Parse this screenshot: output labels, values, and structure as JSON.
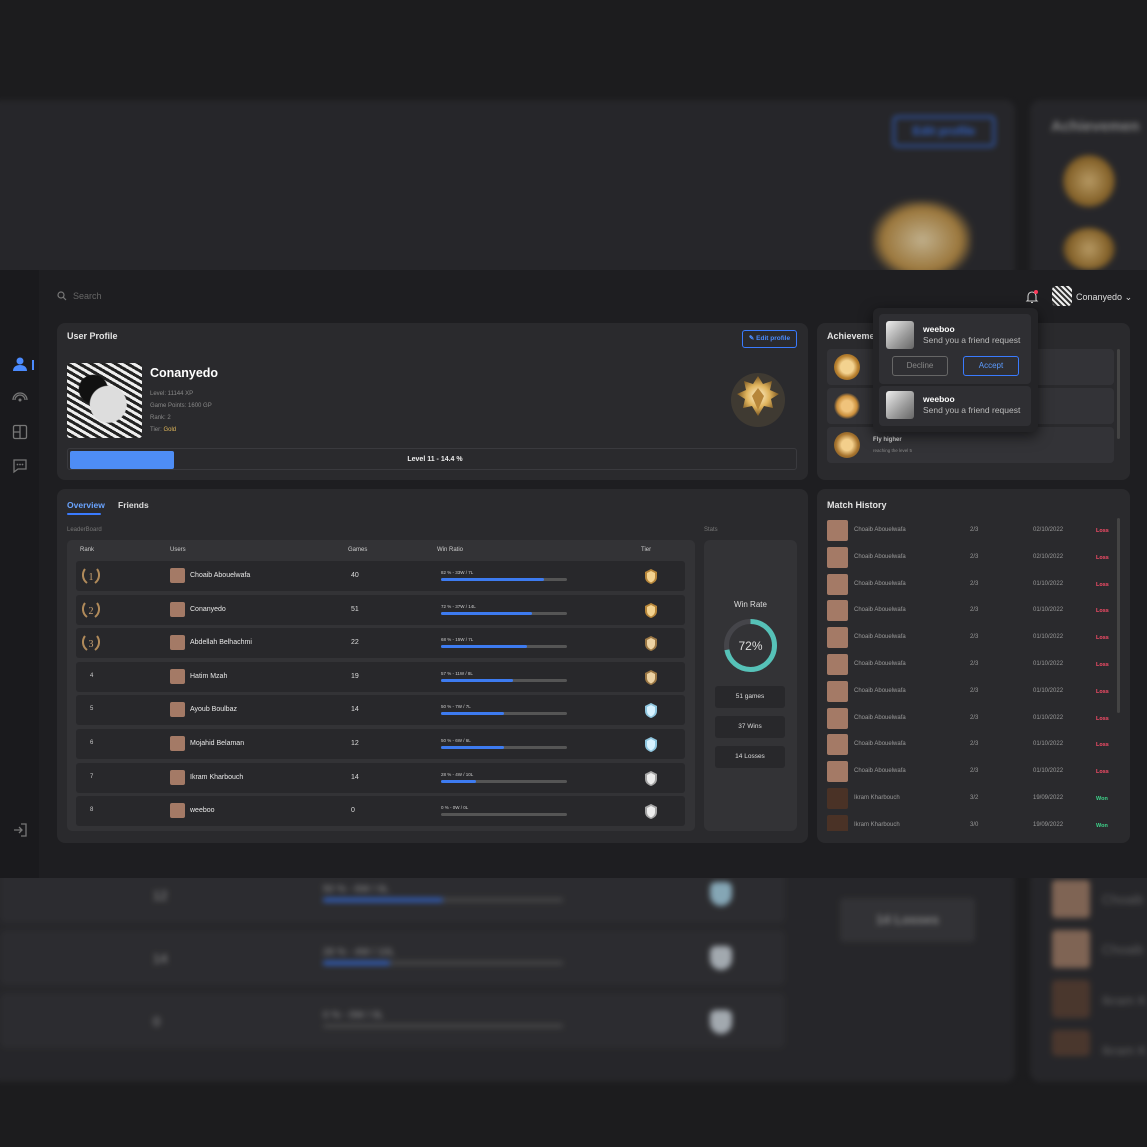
{
  "background": {
    "edit_label": "Edit profile",
    "achievements_title": "Achievemen",
    "rows": [
      {
        "games": "12",
        "ratio": "50 % - 6W / 6L",
        "fill": 0.5
      },
      {
        "games": "14",
        "ratio": "28 % - 4W / 10L",
        "fill": 0.28
      },
      {
        "games": "0",
        "ratio": "0 % - 0W / 0L",
        "fill": 0
      }
    ],
    "losses": "14 Losses",
    "names": [
      "Choaib",
      "Choaib",
      "Ikram K",
      "Ikram K"
    ]
  },
  "sidebar": {
    "icons": [
      "user-icon",
      "radar-icon",
      "game-board-icon",
      "chat-icon",
      "logout-icon"
    ]
  },
  "topbar": {
    "search_placeholder": "Search",
    "username": "Conanyedo",
    "chevron": "⌄"
  },
  "profile": {
    "title": "User Profile",
    "edit_label": "Edit profile",
    "name": "Conanyedo",
    "level": "Level: 11144 XP",
    "points": "Game Points: 1600 GP",
    "rank": "Rank: 2",
    "tier_label": "Tier:",
    "tier": "Gold",
    "xp_text": "Level 11 - 14.4 %",
    "xp_progress": 0.144
  },
  "achievements": {
    "title": "Achievemen",
    "items": [
      {
        "name": "",
        "desc": ""
      },
      {
        "name": "",
        "desc": ""
      },
      {
        "name": "Fly higher",
        "desc": "reaching the level 5"
      }
    ]
  },
  "notifications": {
    "items": [
      {
        "name": "weeboo",
        "message": "Send you a friend request"
      },
      {
        "name": "weeboo",
        "message": "Send you a friend request"
      }
    ],
    "decline": "Decline",
    "accept": "Accept"
  },
  "tabs": {
    "overview": "Overview",
    "friends": "Friends"
  },
  "leaderboard": {
    "label": "LeaderBoard",
    "headers": {
      "rank": "Rank",
      "users": "Users",
      "games": "Games",
      "ratio": "Win Ratio",
      "tier": "Tier"
    },
    "rows": [
      {
        "rank": "1",
        "user": "Choaib Abouelwafa",
        "games": "40",
        "ratio": "82 % - 33W / 7L",
        "fill": 0.82,
        "tier": "gold"
      },
      {
        "rank": "2",
        "user": "Conanyedo",
        "games": "51",
        "ratio": "72 % - 37W / 14L",
        "fill": 0.72,
        "tier": "gold"
      },
      {
        "rank": "3",
        "user": "Abdellah Belhachmi",
        "games": "22",
        "ratio": "68 % - 15W / 7L",
        "fill": 0.68,
        "tier": "silver"
      },
      {
        "rank": "4",
        "user": "Hatim Mzah",
        "games": "19",
        "ratio": "57 % - 11W / 8L",
        "fill": 0.57,
        "tier": "silver"
      },
      {
        "rank": "5",
        "user": "Ayoub Boulbaz",
        "games": "14",
        "ratio": "50 % - 7W / 7L",
        "fill": 0.5,
        "tier": "diamond"
      },
      {
        "rank": "6",
        "user": "Mojahid Belaman",
        "games": "12",
        "ratio": "50 % - 6W / 6L",
        "fill": 0.5,
        "tier": "diamond"
      },
      {
        "rank": "7",
        "user": "Ikram Kharbouch",
        "games": "14",
        "ratio": "28 % - 4W / 10L",
        "fill": 0.28,
        "tier": "platinum"
      },
      {
        "rank": "8",
        "user": "weeboo",
        "games": "0",
        "ratio": "0 % - 0W / 0L",
        "fill": 0,
        "tier": "platinum"
      }
    ]
  },
  "stats": {
    "label": "Stats",
    "win_rate_label": "Win Rate",
    "win_rate": "72%",
    "win_rate_value": 0.72,
    "games": "51 games",
    "wins": "37 Wins",
    "losses": "14 Losses"
  },
  "match_history": {
    "title": "Match History",
    "rows": [
      {
        "name": "Choaib Abouelwafa",
        "score": "2/3",
        "date": "02/10/2022",
        "result": "Loss"
      },
      {
        "name": "Choaib Abouelwafa",
        "score": "2/3",
        "date": "02/10/2022",
        "result": "Loss"
      },
      {
        "name": "Choaib Abouelwafa",
        "score": "2/3",
        "date": "01/10/2022",
        "result": "Loss"
      },
      {
        "name": "Choaib Abouelwafa",
        "score": "2/3",
        "date": "01/10/2022",
        "result": "Loss"
      },
      {
        "name": "Choaib Abouelwafa",
        "score": "2/3",
        "date": "01/10/2022",
        "result": "Loss"
      },
      {
        "name": "Choaib Abouelwafa",
        "score": "2/3",
        "date": "01/10/2022",
        "result": "Loss"
      },
      {
        "name": "Choaib Abouelwafa",
        "score": "2/3",
        "date": "01/10/2022",
        "result": "Loss"
      },
      {
        "name": "Choaib Abouelwafa",
        "score": "2/3",
        "date": "01/10/2022",
        "result": "Loss"
      },
      {
        "name": "Choaib Abouelwafa",
        "score": "2/3",
        "date": "01/10/2022",
        "result": "Loss"
      },
      {
        "name": "Choaib Abouelwafa",
        "score": "2/3",
        "date": "01/10/2022",
        "result": "Loss"
      },
      {
        "name": "Ikram Kharbouch",
        "score": "3/2",
        "date": "19/09/2022",
        "result": "Won"
      },
      {
        "name": "Ikram Kharbouch",
        "score": "3/0",
        "date": "19/09/2022",
        "result": "Won"
      }
    ]
  },
  "colors": {
    "accent": "#3a7bff",
    "loss": "#ff4d6a",
    "win": "#3ed38a",
    "gold": "#e0b75a",
    "donut": "#56c2b8"
  }
}
